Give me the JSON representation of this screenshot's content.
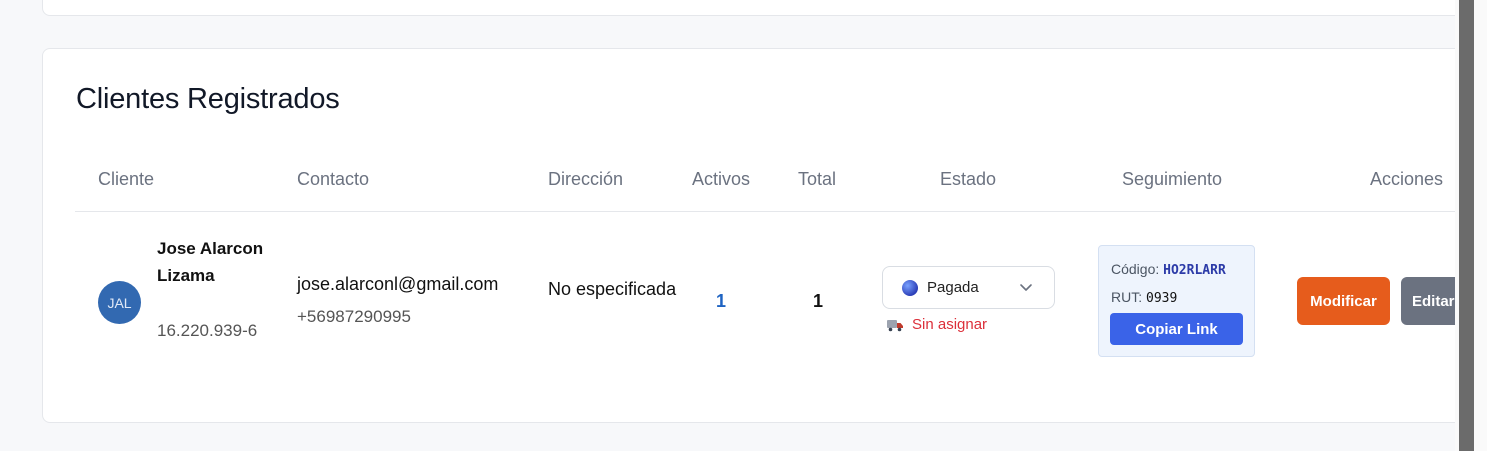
{
  "section": {
    "title": "Clientes Registrados"
  },
  "table": {
    "headers": [
      "Cliente",
      "Contacto",
      "Dirección",
      "Activos",
      "Total",
      "Estado",
      "Seguimiento",
      "Acciones"
    ],
    "rows": [
      {
        "avatar_initials": "JAL",
        "name": "Jose Alarcon Lizama",
        "rut": "16.220.939-6",
        "email": "jose.alarconl@gmail.com",
        "phone": "+56987290995",
        "address": "No especificada",
        "activos": "1",
        "total": "1",
        "estado": {
          "selected": "Pagada",
          "assignment": "Sin asignar"
        },
        "seguimiento": {
          "codigo_label": "Código:",
          "codigo": "HO2RLARR",
          "rut_label": "RUT:",
          "rut_value": "0939",
          "copy_label": "Copiar Link"
        },
        "actions": {
          "modify_label": "Modificar",
          "edit_label": "Editar"
        }
      }
    ]
  },
  "colors": {
    "avatar": "#3269b1",
    "modify_button": "#e65c1c",
    "edit_button": "#6b7280",
    "copy_button": "#3a63e8",
    "unassigned_text": "#dc2f3a"
  },
  "icons": {
    "status_dot": "globe-dot-icon",
    "dropdown": "chevron-down-icon",
    "assignment": "truck-icon"
  }
}
